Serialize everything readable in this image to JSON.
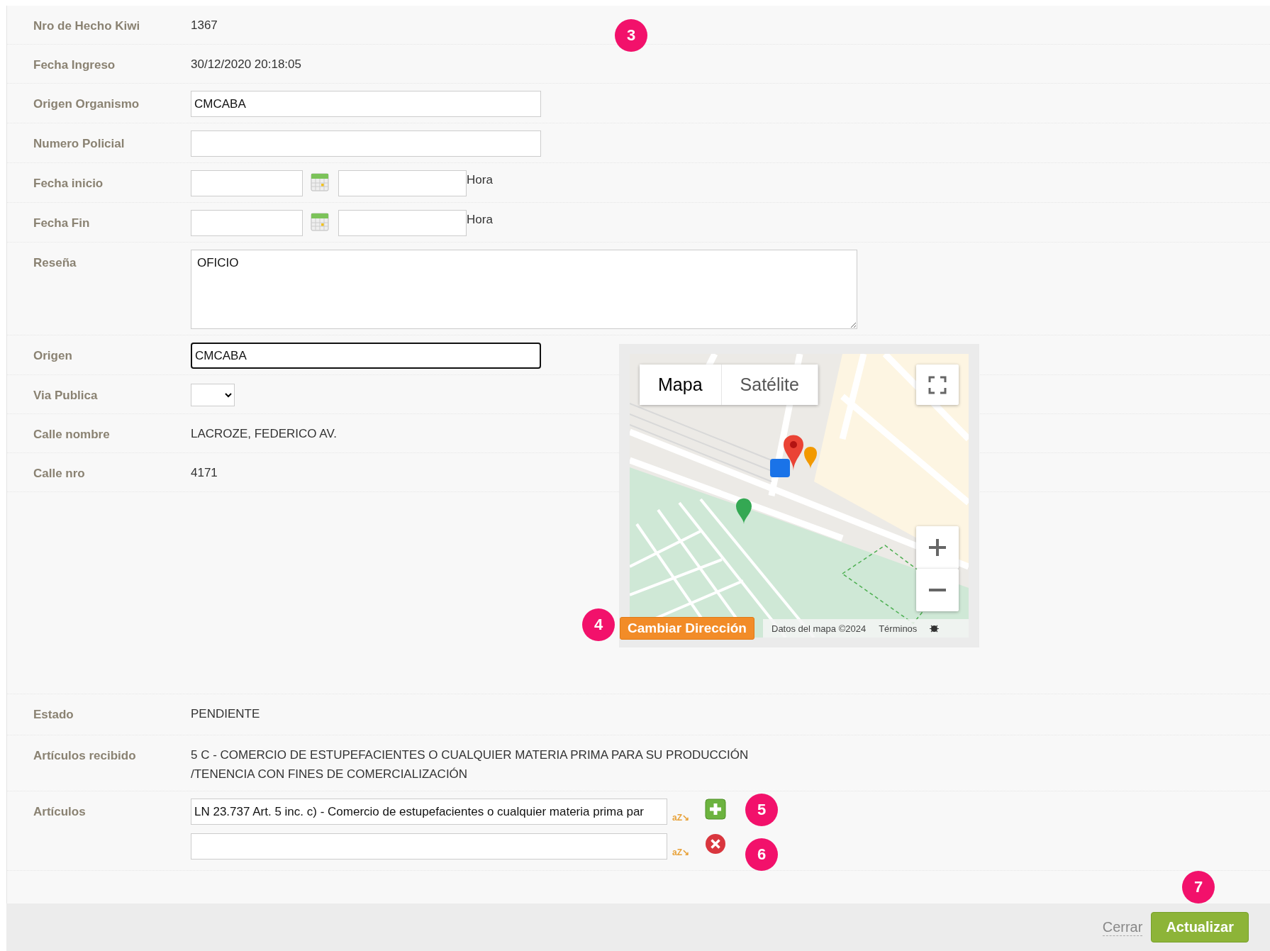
{
  "fields": [
    {
      "kind": "text",
      "label": "Nro de Hecho Kiwi",
      "value": "1367"
    },
    {
      "kind": "text",
      "label": "Fecha Ingreso",
      "value": "30/12/2020 20:18:05"
    },
    {
      "kind": "input",
      "label": "Origen Organismo",
      "value": "CMCABA",
      "focused": false
    },
    {
      "kind": "input",
      "label": "Numero Policial",
      "focused": false
    },
    {
      "kind": "date",
      "label": "Fecha inicio",
      "time_label": "Hora"
    },
    {
      "kind": "date",
      "label": "Fecha Fin",
      "time_label": "Hora"
    },
    {
      "kind": "textarea",
      "label": "Reseña",
      "value": "OFICIO"
    },
    {
      "kind": "input",
      "label": "Origen",
      "value": "CMCABA",
      "focused": true
    },
    {
      "kind": "select",
      "label": "Via Publica"
    },
    {
      "kind": "text",
      "label": "Calle nombre",
      "value": "LACROZE, FEDERICO AV."
    },
    {
      "kind": "text",
      "label": "Calle nro",
      "value": "4171"
    }
  ],
  "map": {
    "map_types": [
      {
        "label": "Mapa",
        "selected": true
      },
      {
        "label": "Satélite",
        "selected": false
      }
    ],
    "attribution": "Datos del mapa ©2024",
    "terms": "Términos",
    "change_address_button": "Cambiar Dirección"
  },
  "lower_fields": [
    {
      "label": "Estado",
      "lines": [
        "PENDIENTE"
      ]
    },
    {
      "label": "Artículos recibido",
      "lines": [
        "5 C - COMERCIO DE ESTUPEFACIENTES O CUALQUIER MATERIA PRIMA PARA SU PRODUCCIÓN",
        "/TENENCIA CON FINES DE COMERCIALIZACIÓN"
      ]
    }
  ],
  "articulos": {
    "label": "Artículos",
    "entries": [
      {
        "value": "LN 23.737 Art. 5 inc. c) - Comercio de estupefacientes o cualquier materia prima par",
        "sort_glyph": "aZ↘",
        "kind": "add"
      },
      {
        "sort_glyph": "aZ↘",
        "kind": "remove"
      }
    ]
  },
  "callouts": [
    "3",
    "4",
    "5",
    "6",
    "7"
  ],
  "footer": {
    "close": "Cerrar",
    "submit": "Actualizar"
  }
}
